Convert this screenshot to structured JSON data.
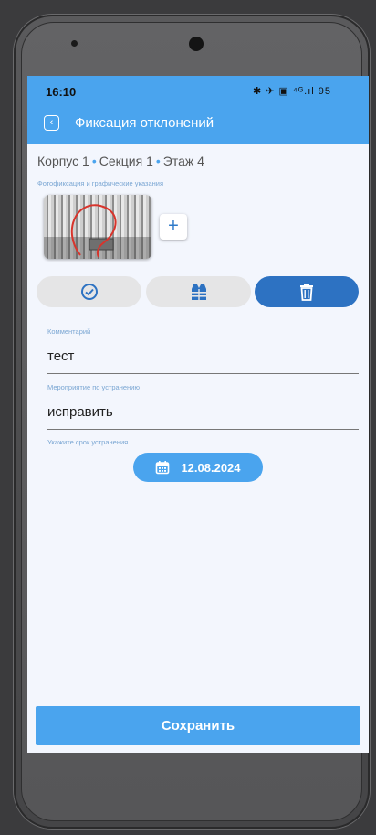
{
  "status_bar": {
    "time": "16:10",
    "icons": "✱ ✈ ▣ ⁴ᴳ.ıl 95"
  },
  "header": {
    "back_icon": "chevron-left-icon",
    "title": "Фиксация отклонений"
  },
  "location": {
    "building": "Корпус 1",
    "section": "Секция 1",
    "floor": "Этаж 4"
  },
  "photos": {
    "label": "Фотофиксация и графические указания",
    "add_symbol": "+"
  },
  "actions": {
    "check_icon": "check-circle-icon",
    "vest_icon": "safety-vest-icon",
    "delete_icon": "trash-icon"
  },
  "comment": {
    "label": "Комментарий",
    "value": "тест"
  },
  "measure": {
    "label": "Мероприятие по устранению",
    "value": "исправить"
  },
  "deadline": {
    "label": "Укажите срок устранения",
    "date": "12.08.2024",
    "icon": "calendar-icon"
  },
  "save": {
    "label": "Сохранить"
  },
  "colors": {
    "primary": "#4aa4ee",
    "delete_button": "#2d72c2",
    "neutral_button": "#e5e5e6",
    "background": "#f3f6fd"
  }
}
